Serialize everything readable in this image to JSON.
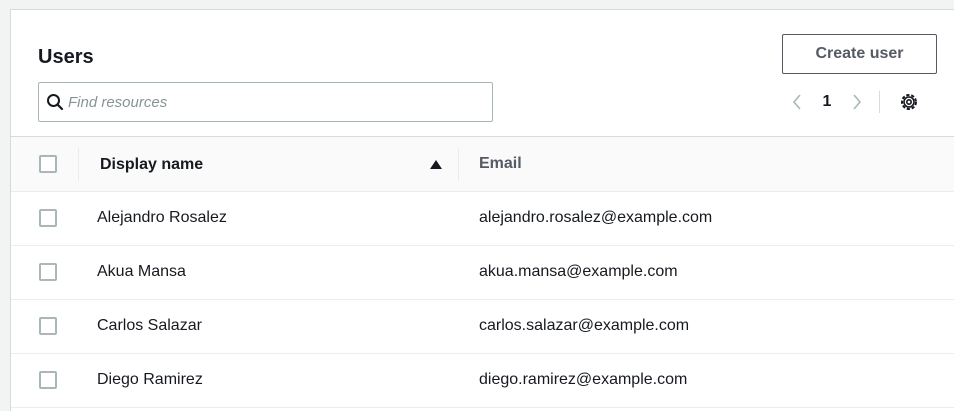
{
  "header": {
    "title": "Users",
    "create_label": "Create user"
  },
  "search": {
    "placeholder": "Find resources",
    "value": "",
    "icon": "search-icon"
  },
  "pagination": {
    "current_page": "1",
    "prev_icon": "chevron-left-icon",
    "next_icon": "chevron-right-icon",
    "settings_icon": "gear-icon"
  },
  "table": {
    "columns": [
      {
        "label": "Display name",
        "sorted": "ascending"
      },
      {
        "label": "Email"
      }
    ],
    "rows": [
      {
        "name": "Alejandro Rosalez",
        "email": "alejandro.rosalez@example.com"
      },
      {
        "name": "Akua Mansa",
        "email": "akua.mansa@example.com"
      },
      {
        "name": "Carlos Salazar",
        "email": "carlos.salazar@example.com"
      },
      {
        "name": "Diego Ramirez",
        "email": "diego.ramirez@example.com"
      }
    ]
  },
  "colors": {
    "page_bg": "#f2f3f3",
    "border": "#d5dbdb",
    "text": "#16191f",
    "secondary_text": "#545b64",
    "placeholder": "#879596"
  }
}
